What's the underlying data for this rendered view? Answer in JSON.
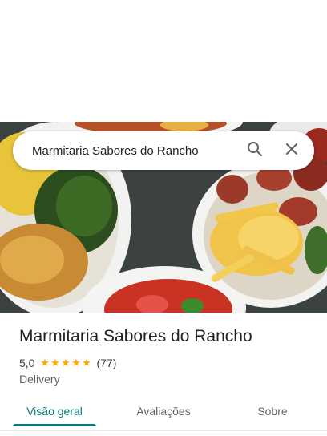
{
  "search": {
    "query": "Marmitaria Sabores do Rancho",
    "search_icon": "search-icon",
    "close_icon": "close-icon"
  },
  "place": {
    "name": "Marmitaria Sabores do Rancho",
    "rating": "5,0",
    "stars": 5,
    "review_count": "(77)",
    "category": "Delivery"
  },
  "tabs": [
    {
      "label": "Visão geral",
      "active": true
    },
    {
      "label": "Avaliações",
      "active": false
    },
    {
      "label": "Sobre",
      "active": false
    }
  ],
  "colors": {
    "accent": "#0b7a75",
    "star": "#f9ab00"
  }
}
